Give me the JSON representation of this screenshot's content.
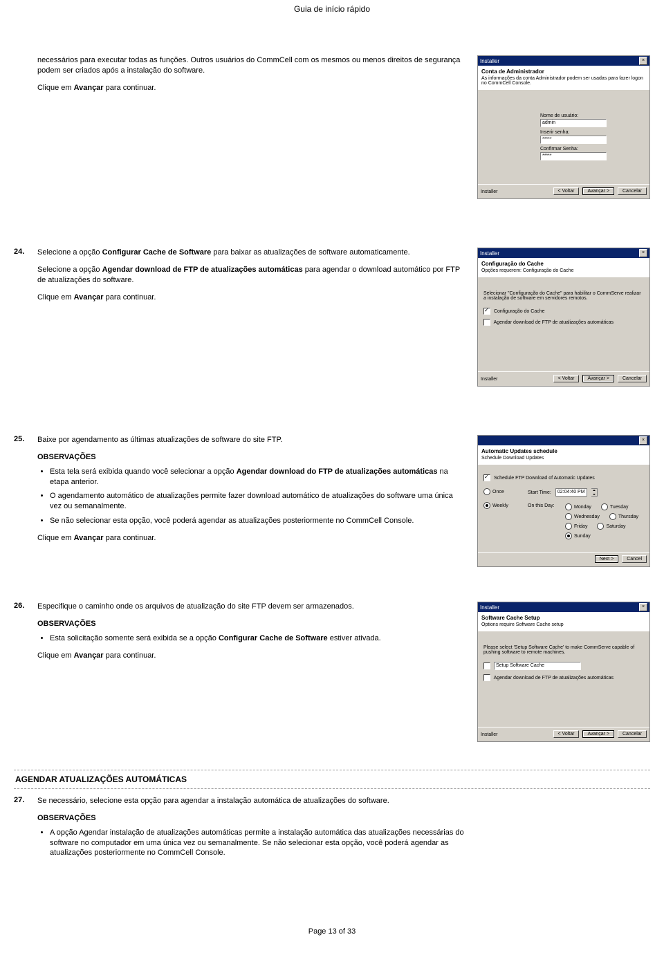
{
  "header": {
    "title": "Guia de início rápido"
  },
  "footer": {
    "text": "Page 13 of 33"
  },
  "common": {
    "avancar": "Clique em Avançar para continuar.",
    "observ": "OBSERVAÇÕES",
    "installer_word": "Installer",
    "btn_back": "< Voltar",
    "btn_next": "Avançar >",
    "btn_cancel": "Cancelar",
    "btn_next_en": "Next >",
    "btn_cancel_en": "Cancel",
    "close_x": "×"
  },
  "steps": {
    "s23": {
      "text": "necessários para executar todas as funções. Outros usuários do CommCell com os mesmos ou menos direitos de segurança podem ser criados após a instalação do software.",
      "dlg": {
        "title": "Installer",
        "heading": "Conta de Administrador",
        "sub": "As informações da conta Administrador podem ser usadas para fazer logon no CommCell Console.",
        "f1_lbl": "Nome de usuário:",
        "f1_val": "admin",
        "f2_lbl": "Inserir senha:",
        "f2_val": "*****",
        "f3_lbl": "Confirmar Senha:",
        "f3_val": "*****"
      }
    },
    "s24": {
      "num": "24.",
      "p1a": "Selecione a opção ",
      "p1b": "Configurar Cache de Software",
      "p1c": " para baixar as atualizações de software automaticamente.",
      "p2a": "Selecione a opção ",
      "p2b": "Agendar download de FTP de atualizações automáticas",
      "p2c": " para agendar o download automático por FTP de atualizações do software.",
      "dlg": {
        "title": "Installer",
        "heading": "Configuração do Cache",
        "sub": "Opções requerem: Configuração do Cache",
        "body": "Selecionar \"Configuração do Cache\" para habilitar o CommServe realizar a instalação de software em servidores remotos.",
        "chk1": "Configuração do Cache",
        "chk2": "Agendar download de FTP de atualizações automáticas"
      }
    },
    "s25": {
      "num": "25.",
      "p1": "Baixe por agendamento as últimas atualizações de software do site FTP.",
      "b1a": "Esta tela será exibida quando você selecionar a opção ",
      "b1b": "Agendar download do FTP de atualizações automáticas",
      "b1c": " na etapa anterior.",
      "b2": "O agendamento automático de atualizações permite fazer download automático de atualizações do software uma única vez ou semanalmente.",
      "b3": "Se não selecionar esta opção, você poderá agendar as atualizações posteriormente no CommCell Console.",
      "dlg": {
        "heading": "Automatic Updates schedule",
        "sub": "Schedule Download Updates",
        "chk": "Schedule FTP Download of Automatic Updates",
        "once": "Once",
        "weekly": "Weekly",
        "start": "Start Time:",
        "time": "02:04:40 PM",
        "onday": "On this Day:",
        "days": {
          "mon": "Monday",
          "tue": "Tuesday",
          "wed": "Wednesday",
          "thu": "Thursday",
          "fri": "Friday",
          "sat": "Saturday",
          "sun": "Sunday"
        }
      }
    },
    "s26": {
      "num": "26.",
      "p1": "Especifique o caminho onde os arquivos de atualização do site FTP devem ser armazenados.",
      "b1a": "Esta solicitação somente será exibida se a opção ",
      "b1b": "Configurar Cache de Software",
      "b1c": " estiver ativada.",
      "dlg": {
        "title": "Installer",
        "heading": "Software Cache Setup",
        "sub": "Options require Software Cache setup",
        "body": "Please select 'Setup Software Cache' to make CommServe capable of pushing software to remote machines.",
        "chk1": "Setup Software Cache",
        "chk2": "Agendar download de FTP de atualizações automáticas"
      }
    },
    "section": "AGENDAR ATUALIZAÇÕES AUTOMÁTICAS",
    "s27": {
      "num": "27.",
      "p1": "Se necessário, selecione esta opção para agendar a instalação automática de atualizações do software.",
      "b1": "A opção Agendar instalação de atualizações automáticas permite a instalação automática das atualizações necessárias do software no computador em uma única vez ou semanalmente. Se não selecionar esta opção, você poderá agendar as atualizações posteriormente no CommCell Console."
    }
  }
}
